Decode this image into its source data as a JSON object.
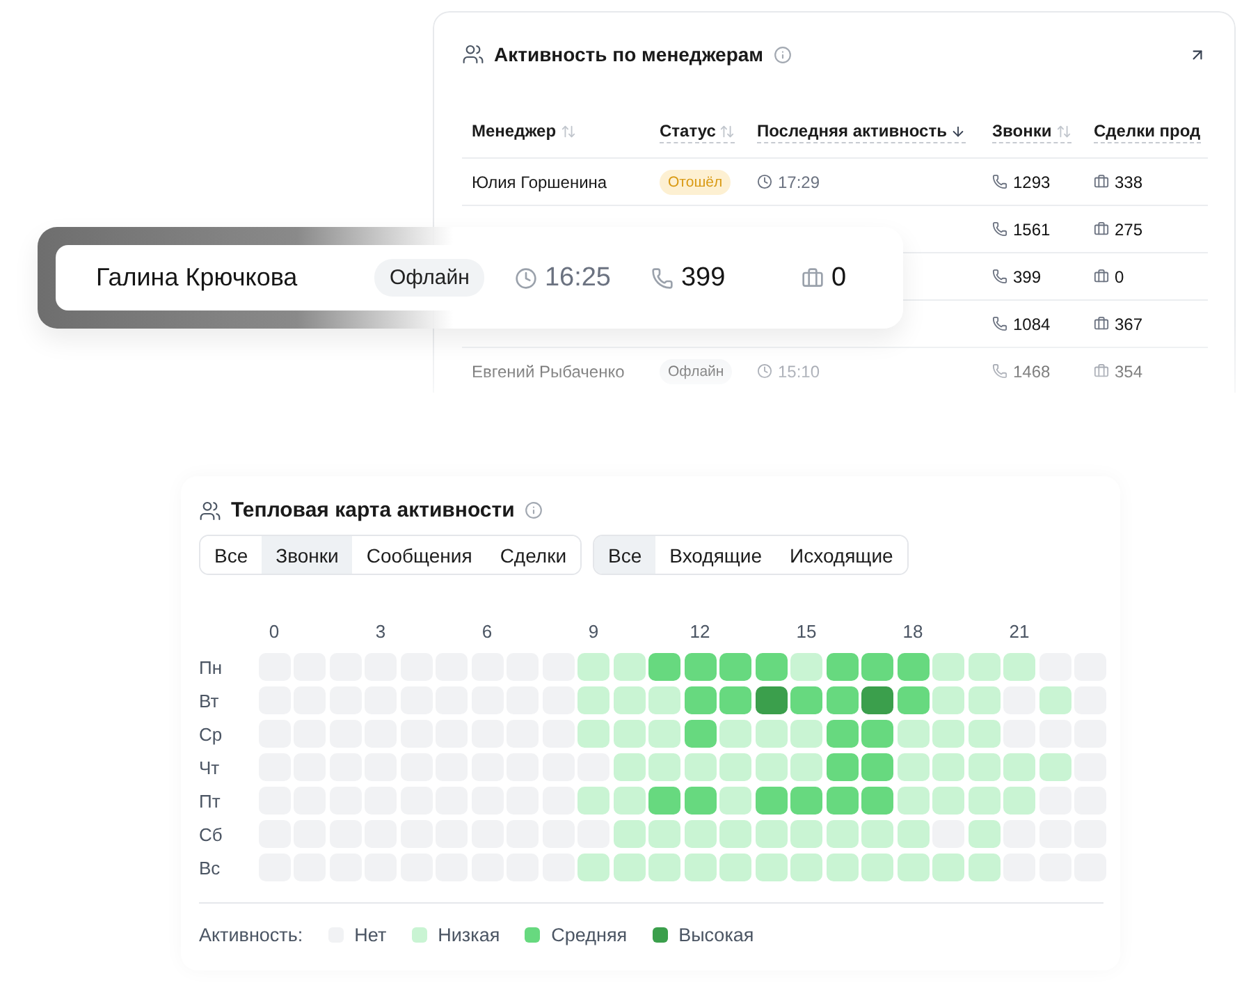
{
  "managers_card": {
    "title": "Активность по менеджерам",
    "columns": [
      {
        "label": "Менеджер",
        "kind": "sortable",
        "underlined": false
      },
      {
        "label": "Статус",
        "kind": "sortable",
        "underlined": true
      },
      {
        "label": "Последняя активность",
        "kind": "sorted",
        "underlined": true
      },
      {
        "label": "Звонки",
        "kind": "sortable",
        "underlined": true
      },
      {
        "label": "Сделки прод",
        "kind": "plain",
        "underlined": true
      }
    ],
    "rows": [
      {
        "name": "Юлия Горшенина",
        "status": {
          "label": "Отошёл",
          "kind": "away"
        },
        "time": "17:29",
        "calls": "1293",
        "deals": "338"
      },
      {
        "calls": "1561",
        "deals": "275"
      },
      {
        "calls": "399",
        "deals": "0"
      },
      {
        "calls": "1084",
        "deals": "367"
      },
      {
        "name": "Евгений Рыбаченко",
        "status": {
          "label": "Офлайн",
          "kind": "offline"
        },
        "time": "15:10",
        "calls": "1468",
        "deals": "354"
      }
    ]
  },
  "highlight_row": {
    "name": "Галина Крючкова",
    "status": {
      "label": "Офлайн",
      "kind": "offline"
    },
    "time": "16:25",
    "calls": "399",
    "deals": "0"
  },
  "heatmap": {
    "title": "Тепловая карта активности",
    "filter_groups": [
      [
        {
          "label": "Все",
          "selected": false
        },
        {
          "label": "Звонки",
          "selected": true
        },
        {
          "label": "Сообщения",
          "selected": false
        },
        {
          "label": "Сделки",
          "selected": false
        }
      ],
      [
        {
          "label": "Все",
          "selected": true
        },
        {
          "label": "Входящие",
          "selected": false
        },
        {
          "label": "Исходящие",
          "selected": false
        }
      ]
    ],
    "hours": [
      "0",
      "3",
      "6",
      "9",
      "12",
      "15",
      "18",
      "21"
    ],
    "rows": [
      {
        "day": "Пн",
        "cells": [
          {
            "kind": "none"
          },
          {
            "kind": "none"
          },
          {
            "kind": "none"
          },
          {
            "kind": "none"
          },
          {
            "kind": "none"
          },
          {
            "kind": "none"
          },
          {
            "kind": "none"
          },
          {
            "kind": "none"
          },
          {
            "kind": "none"
          },
          {
            "kind": "low"
          },
          {
            "kind": "low"
          },
          {
            "kind": "medium"
          },
          {
            "kind": "medium"
          },
          {
            "kind": "medium"
          },
          {
            "kind": "medium"
          },
          {
            "kind": "low"
          },
          {
            "kind": "medium"
          },
          {
            "kind": "medium"
          },
          {
            "kind": "medium"
          },
          {
            "kind": "low"
          },
          {
            "kind": "low"
          },
          {
            "kind": "low"
          },
          {
            "kind": "none"
          },
          {
            "kind": "none"
          }
        ]
      },
      {
        "day": "Вт",
        "cells": [
          {
            "kind": "none"
          },
          {
            "kind": "none"
          },
          {
            "kind": "none"
          },
          {
            "kind": "none"
          },
          {
            "kind": "none"
          },
          {
            "kind": "none"
          },
          {
            "kind": "none"
          },
          {
            "kind": "none"
          },
          {
            "kind": "none"
          },
          {
            "kind": "low"
          },
          {
            "kind": "low"
          },
          {
            "kind": "low"
          },
          {
            "kind": "medium"
          },
          {
            "kind": "medium"
          },
          {
            "kind": "high"
          },
          {
            "kind": "medium"
          },
          {
            "kind": "medium"
          },
          {
            "kind": "high"
          },
          {
            "kind": "medium"
          },
          {
            "kind": "low"
          },
          {
            "kind": "low"
          },
          {
            "kind": "none"
          },
          {
            "kind": "low"
          },
          {
            "kind": "none"
          }
        ]
      },
      {
        "day": "Ср",
        "cells": [
          {
            "kind": "none"
          },
          {
            "kind": "none"
          },
          {
            "kind": "none"
          },
          {
            "kind": "none"
          },
          {
            "kind": "none"
          },
          {
            "kind": "none"
          },
          {
            "kind": "none"
          },
          {
            "kind": "none"
          },
          {
            "kind": "none"
          },
          {
            "kind": "low"
          },
          {
            "kind": "low"
          },
          {
            "kind": "low"
          },
          {
            "kind": "medium"
          },
          {
            "kind": "low"
          },
          {
            "kind": "low"
          },
          {
            "kind": "low"
          },
          {
            "kind": "medium"
          },
          {
            "kind": "medium"
          },
          {
            "kind": "low"
          },
          {
            "kind": "low"
          },
          {
            "kind": "low"
          },
          {
            "kind": "none"
          },
          {
            "kind": "none"
          },
          {
            "kind": "none"
          }
        ]
      },
      {
        "day": "Чт",
        "cells": [
          {
            "kind": "none"
          },
          {
            "kind": "none"
          },
          {
            "kind": "none"
          },
          {
            "kind": "none"
          },
          {
            "kind": "none"
          },
          {
            "kind": "none"
          },
          {
            "kind": "none"
          },
          {
            "kind": "none"
          },
          {
            "kind": "none"
          },
          {
            "kind": "none"
          },
          {
            "kind": "low"
          },
          {
            "kind": "low"
          },
          {
            "kind": "low"
          },
          {
            "kind": "low"
          },
          {
            "kind": "low"
          },
          {
            "kind": "low"
          },
          {
            "kind": "medium"
          },
          {
            "kind": "medium"
          },
          {
            "kind": "low"
          },
          {
            "kind": "low"
          },
          {
            "kind": "low"
          },
          {
            "kind": "low"
          },
          {
            "kind": "low"
          },
          {
            "kind": "none"
          }
        ]
      },
      {
        "day": "Пт",
        "cells": [
          {
            "kind": "none"
          },
          {
            "kind": "none"
          },
          {
            "kind": "none"
          },
          {
            "kind": "none"
          },
          {
            "kind": "none"
          },
          {
            "kind": "none"
          },
          {
            "kind": "none"
          },
          {
            "kind": "none"
          },
          {
            "kind": "none"
          },
          {
            "kind": "low"
          },
          {
            "kind": "low"
          },
          {
            "kind": "medium"
          },
          {
            "kind": "medium"
          },
          {
            "kind": "low"
          },
          {
            "kind": "medium"
          },
          {
            "kind": "medium"
          },
          {
            "kind": "medium"
          },
          {
            "kind": "medium"
          },
          {
            "kind": "low"
          },
          {
            "kind": "low"
          },
          {
            "kind": "low"
          },
          {
            "kind": "low"
          },
          {
            "kind": "none"
          },
          {
            "kind": "none"
          }
        ]
      },
      {
        "day": "Сб",
        "cells": [
          {
            "kind": "none"
          },
          {
            "kind": "none"
          },
          {
            "kind": "none"
          },
          {
            "kind": "none"
          },
          {
            "kind": "none"
          },
          {
            "kind": "none"
          },
          {
            "kind": "none"
          },
          {
            "kind": "none"
          },
          {
            "kind": "none"
          },
          {
            "kind": "none"
          },
          {
            "kind": "low"
          },
          {
            "kind": "low"
          },
          {
            "kind": "low"
          },
          {
            "kind": "low"
          },
          {
            "kind": "low"
          },
          {
            "kind": "low"
          },
          {
            "kind": "low"
          },
          {
            "kind": "low"
          },
          {
            "kind": "low"
          },
          {
            "kind": "none"
          },
          {
            "kind": "low"
          },
          {
            "kind": "none"
          },
          {
            "kind": "none"
          },
          {
            "kind": "none"
          }
        ]
      },
      {
        "day": "Вс",
        "cells": [
          {
            "kind": "none"
          },
          {
            "kind": "none"
          },
          {
            "kind": "none"
          },
          {
            "kind": "none"
          },
          {
            "kind": "none"
          },
          {
            "kind": "none"
          },
          {
            "kind": "none"
          },
          {
            "kind": "none"
          },
          {
            "kind": "none"
          },
          {
            "kind": "low"
          },
          {
            "kind": "low"
          },
          {
            "kind": "low"
          },
          {
            "kind": "low"
          },
          {
            "kind": "low"
          },
          {
            "kind": "low"
          },
          {
            "kind": "low"
          },
          {
            "kind": "low"
          },
          {
            "kind": "low"
          },
          {
            "kind": "low"
          },
          {
            "kind": "low"
          },
          {
            "kind": "low"
          },
          {
            "kind": "none"
          },
          {
            "kind": "none"
          },
          {
            "kind": "none"
          }
        ]
      }
    ],
    "legend": {
      "label": "Активность:",
      "items": [
        {
          "label": "Нет",
          "kind": "none"
        },
        {
          "label": "Низкая",
          "kind": "low"
        },
        {
          "label": "Средняя",
          "kind": "medium"
        },
        {
          "label": "Высокая",
          "kind": "high"
        }
      ]
    }
  }
}
